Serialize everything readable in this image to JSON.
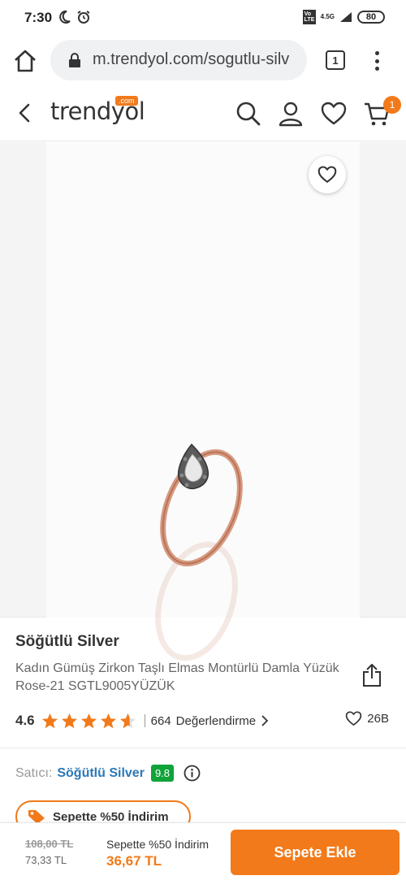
{
  "status": {
    "time": "7:30",
    "battery": "80",
    "network": "4.5G",
    "lte": "Vo LTE"
  },
  "browser": {
    "url": "m.trendyol.com/sogutlu-silv",
    "tab_count": "1"
  },
  "header": {
    "logo_text": "trendyol",
    "logo_com": ".com",
    "cart_badge": "1"
  },
  "product": {
    "brand": "Söğütlü Silver",
    "name": "Kadın Gümüş Zirkon Taşlı Elmas Montürlü Damla Yüzük Rose-21 SGTL9005YÜZÜK",
    "rating": "4.6",
    "rating_value": 4.6,
    "review_count": "664",
    "review_label": "Değerlendirme",
    "favorites": "26B"
  },
  "seller": {
    "label": "Satıcı:",
    "name": "Söğütlü Silver",
    "score": "9.8"
  },
  "promo": {
    "label": "Sepette %50 İndirim"
  },
  "bottom": {
    "old_price": "108,00 TL",
    "discount_price": "73,33 TL",
    "promo_label": "Sepette %50 İndirim",
    "final_price": "36,67 TL",
    "add_button": "Sepete Ekle"
  },
  "colors": {
    "accent": "#f27a1a",
    "seller_link": "#2b79b8",
    "score_badge": "#10a339"
  }
}
